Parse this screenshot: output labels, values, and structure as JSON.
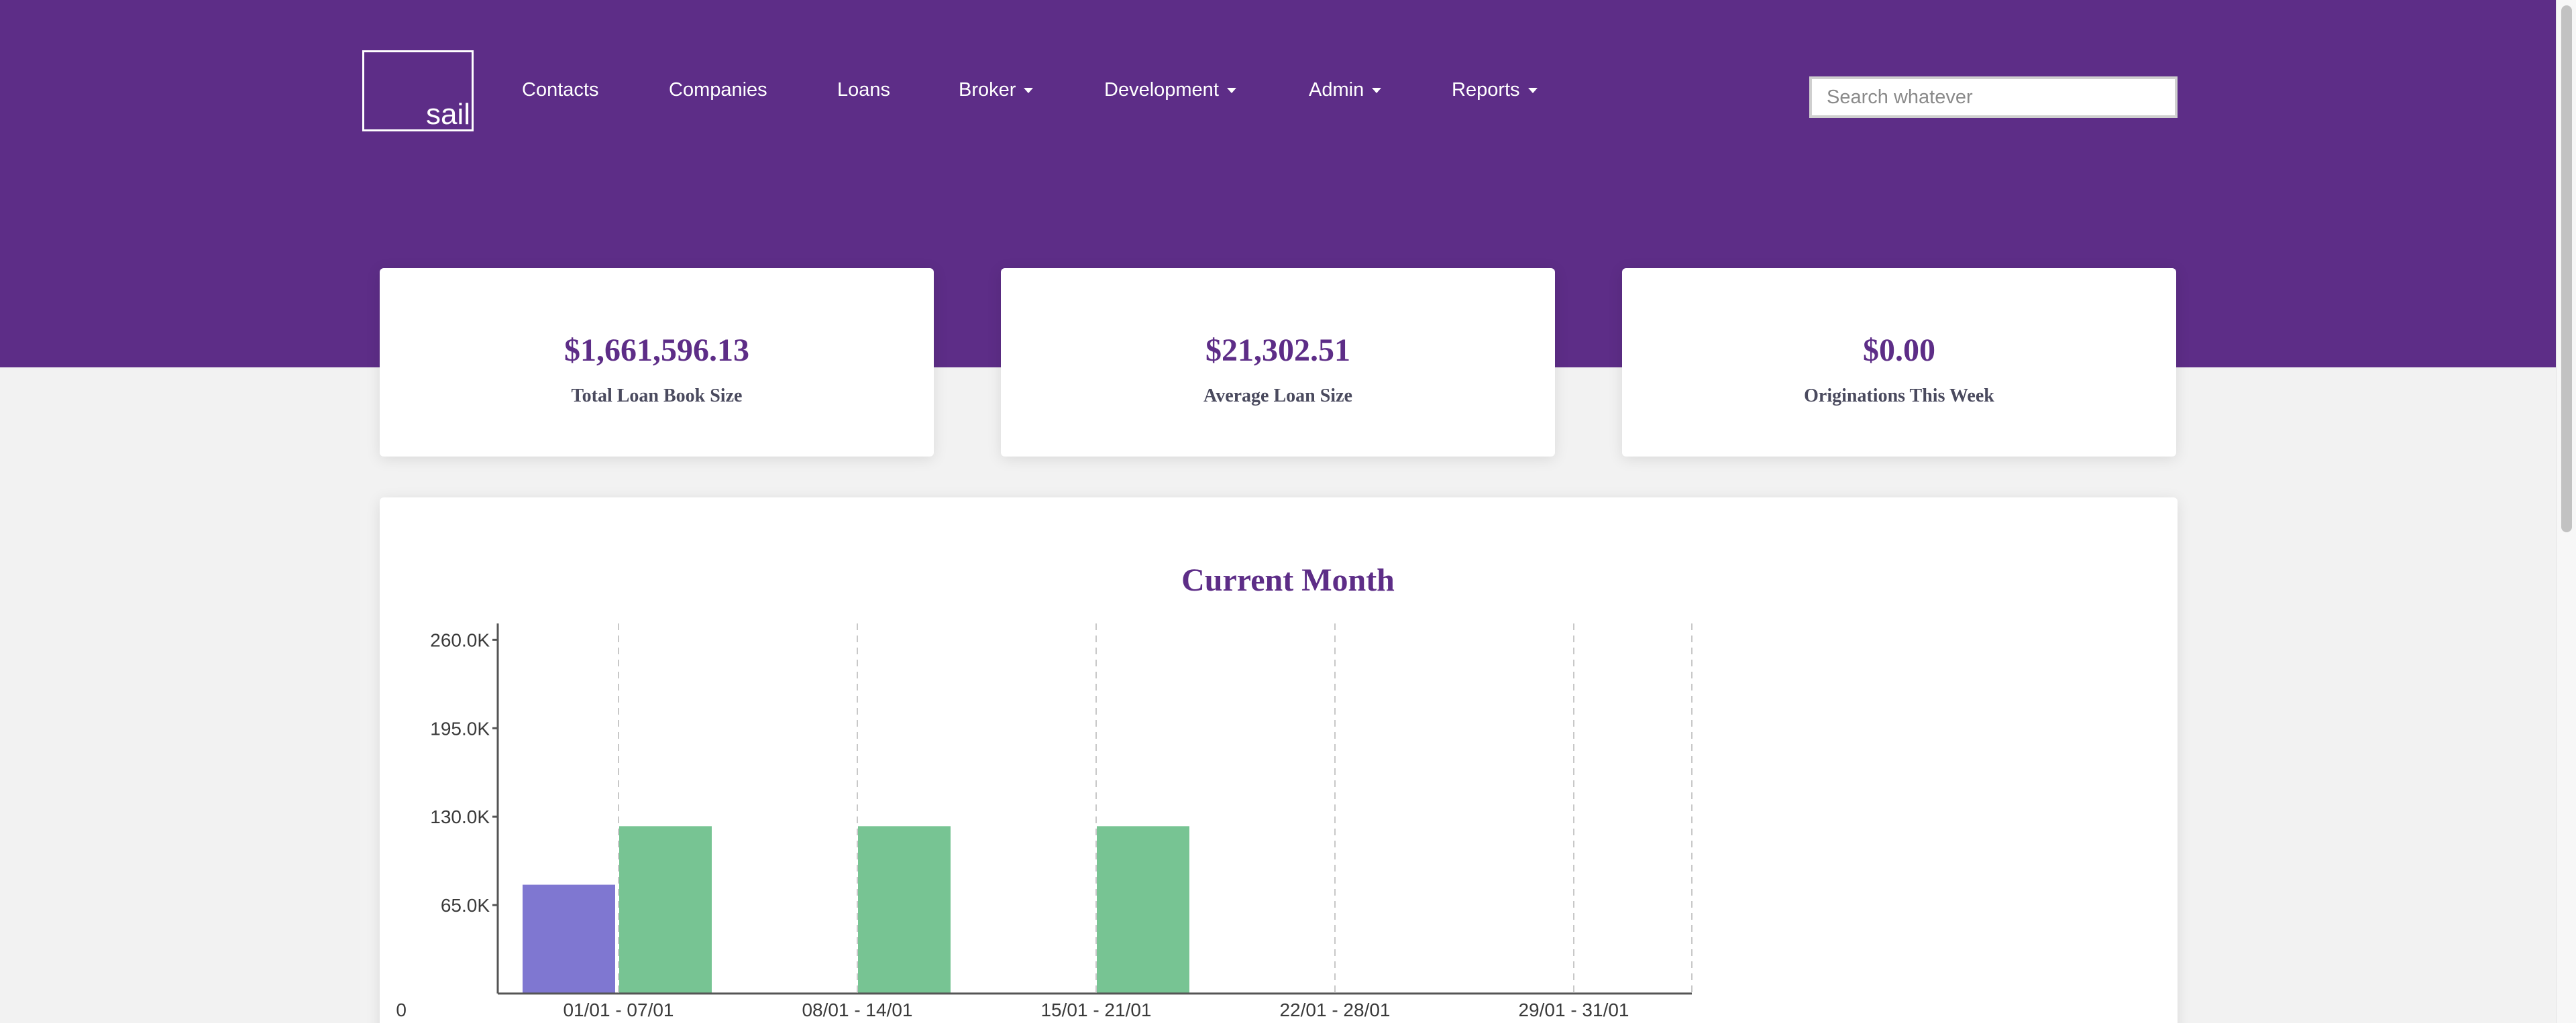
{
  "header": {
    "logo_text": "sail",
    "nav": [
      {
        "label": "Contacts",
        "dropdown": false
      },
      {
        "label": "Companies",
        "dropdown": false
      },
      {
        "label": "Loans",
        "dropdown": false
      },
      {
        "label": "Broker",
        "dropdown": true
      },
      {
        "label": "Development",
        "dropdown": true
      },
      {
        "label": "Admin",
        "dropdown": true
      },
      {
        "label": "Reports",
        "dropdown": true
      }
    ],
    "search": {
      "placeholder": "Search whatever",
      "value": ""
    }
  },
  "stats": [
    {
      "value": "$1,661,596.13",
      "label": "Total Loan Book Size"
    },
    {
      "value": "$21,302.51",
      "label": "Average Loan Size"
    },
    {
      "value": "$0.00",
      "label": "Originations This Week"
    }
  ],
  "colors": {
    "brand": "#5d2d87",
    "series_purple": "#7f77d1",
    "series_green": "#77c493"
  },
  "chart_data": {
    "type": "bar",
    "title": "Current Month",
    "categories": [
      "01/01 - 07/01",
      "08/01 - 14/01",
      "15/01 - 21/01",
      "22/01 - 28/01",
      "29/01 - 31/01"
    ],
    "y_ticks": [
      "0",
      "65.0K",
      "130.0K",
      "195.0K",
      "260.0K"
    ],
    "ylim": [
      0,
      272000
    ],
    "grid": "vertical dashed",
    "series": [
      {
        "values": [
          80000,
          0,
          0,
          0,
          0
        ],
        "color": "#7f77d1"
      },
      {
        "values": [
          123000,
          123000,
          123000,
          0,
          0
        ],
        "color": "#77c493"
      }
    ]
  }
}
